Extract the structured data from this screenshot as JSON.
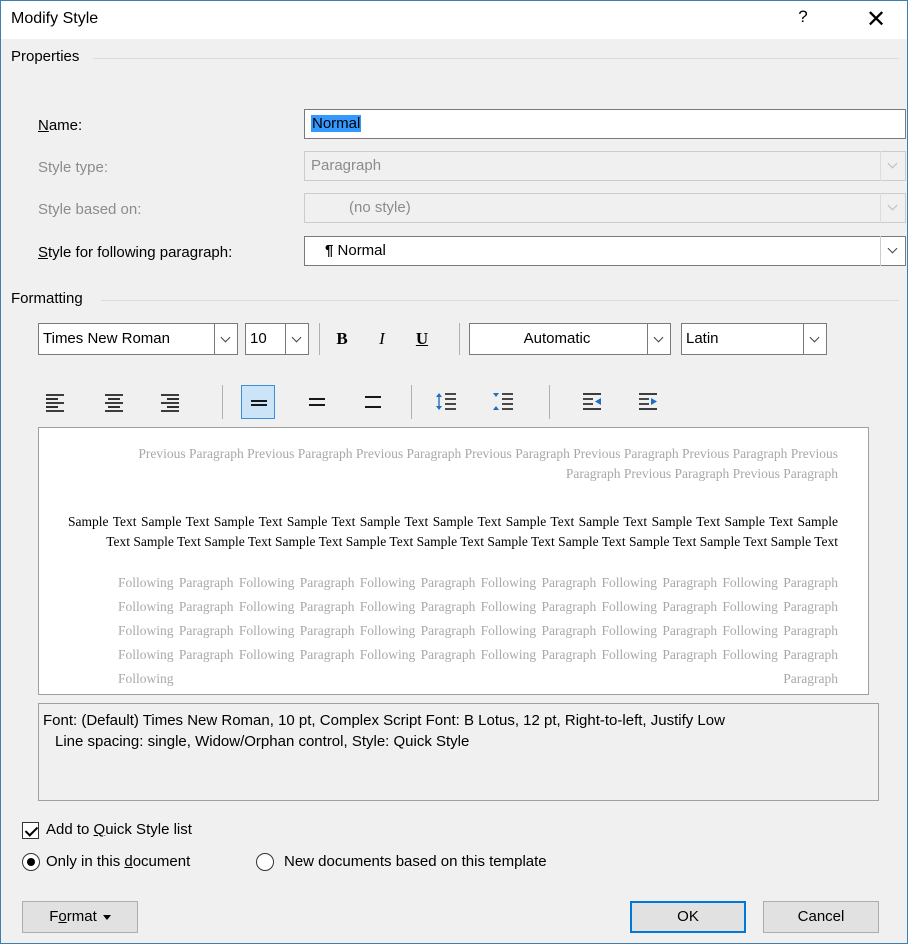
{
  "dialog": {
    "title": "Modify Style",
    "help": "?",
    "close": "✕"
  },
  "properties": {
    "group_label": "Properties",
    "name_label": "Name:",
    "name_value": "Normal",
    "style_type_label": "Style type:",
    "style_type_value": "Paragraph",
    "based_on_label": "Style based on:",
    "based_on_value": "(no style)",
    "following_label": "Style for following paragraph:",
    "following_value": "Normal",
    "pilcrow": "¶"
  },
  "formatting": {
    "group_label": "Formatting",
    "font": "Times New Roman",
    "size": "10",
    "bold": "B",
    "italic": "I",
    "underline": "U",
    "color": "Automatic",
    "script": "Latin"
  },
  "preview": {
    "previous": "Previous Paragraph Previous Paragraph Previous Paragraph Previous Paragraph Previous Paragraph Previous Paragraph Previous Paragraph Previous Paragraph Previous Paragraph",
    "sample": "Sample Text Sample Text Sample Text Sample Text Sample Text Sample Text Sample Text Sample Text Sample Text Sample Text Sample Text Sample Text Sample Text Sample Text Sample Text Sample Text Sample Text Sample Text Sample Text Sample Text Sample Text",
    "following": "Following Paragraph Following Paragraph Following Paragraph Following Paragraph Following Paragraph Following Paragraph Following Paragraph Following Paragraph Following Paragraph Following Paragraph Following Paragraph Following Paragraph Following Paragraph Following Paragraph Following Paragraph Following Paragraph Following Paragraph Following Paragraph Following Paragraph Following Paragraph Following Paragraph Following Paragraph Following Paragraph Following Paragraph Following Paragraph"
  },
  "description": {
    "line1": "Font: (Default) Times New Roman, 10 pt, Complex Script Font: B Lotus, 12 pt, Right-to-left, Justify Low",
    "line2": "Line spacing:  single, Widow/Orphan control, Style: Quick Style"
  },
  "options": {
    "quick_style": "Add to Quick Style list",
    "only_doc": "Only in this document",
    "new_docs": "New documents based on this template"
  },
  "buttons": {
    "format": "Format",
    "ok": "OK",
    "cancel": "Cancel"
  },
  "colors": {
    "accent": "#0078d7",
    "selection": "#3399ff",
    "active_toggle": "#cce4f7"
  }
}
